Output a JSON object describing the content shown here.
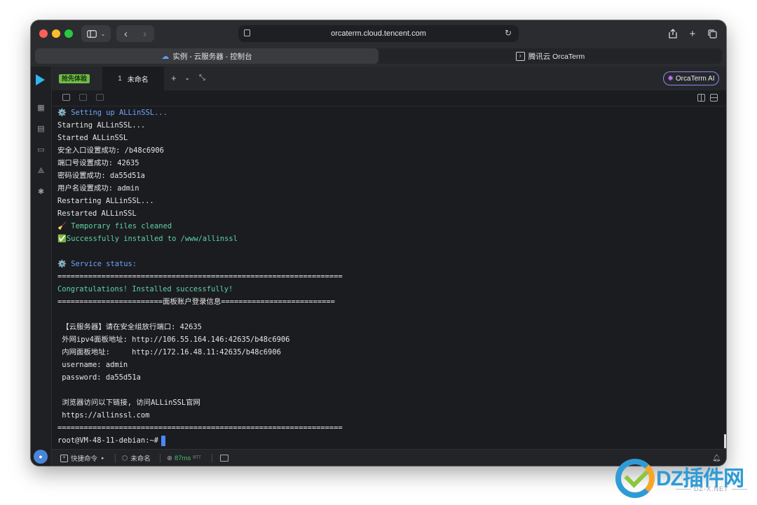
{
  "browser": {
    "url": "orcaterm.cloud.tencent.com",
    "tabs": [
      {
        "label": "实例 - 云服务器 - 控制台",
        "icon": "cloud-icon",
        "active": true
      },
      {
        "label": "腾讯云 OrcaTerm",
        "icon": "terminal-icon",
        "active": false
      }
    ]
  },
  "header": {
    "beta_badge": "抢先体验",
    "session_tab": {
      "number": "1",
      "label": "未命名"
    },
    "ai_button": "OrcaTerm AI"
  },
  "terminal": {
    "lines": [
      {
        "text": "⚙️ Setting up ALLinSSL...",
        "color": "blue"
      },
      {
        "text": "Starting ALLinSSL...",
        "color": "default"
      },
      {
        "text": "Started ALLinSSL",
        "color": "default"
      },
      {
        "text": "安全入口设置成功: /b48c6906",
        "color": "default"
      },
      {
        "text": "端口号设置成功: 42635",
        "color": "default"
      },
      {
        "text": "密码设置成功: da55d51a",
        "color": "default"
      },
      {
        "text": "用户名设置成功: admin",
        "color": "default"
      },
      {
        "text": "Restarting ALLinSSL...",
        "color": "default"
      },
      {
        "text": "Restarted ALLinSSL",
        "color": "default"
      },
      {
        "text": "🧹 Temporary files cleaned",
        "color": "green"
      },
      {
        "text": "✅Successfully installed to /www/allinssl",
        "color": "green"
      },
      {
        "text": "",
        "color": "default"
      },
      {
        "text": "⚙️ Service status:",
        "color": "blue"
      },
      {
        "text": "=================================================================",
        "color": "default"
      },
      {
        "text": "Congratulations! Installed successfully!",
        "color": "green"
      },
      {
        "text": "========================面板账户登录信息==========================",
        "color": "default"
      },
      {
        "text": "",
        "color": "default"
      },
      {
        "text": " 【云服务器】请在安全组放行端口: 42635",
        "color": "default"
      },
      {
        "text": " 外网ipv4面板地址: http://106.55.164.146:42635/b48c6906",
        "color": "default"
      },
      {
        "text": " 内网面板地址:     http://172.16.48.11:42635/b48c6906",
        "color": "default"
      },
      {
        "text": " username: admin",
        "color": "default"
      },
      {
        "text": " password: da55d51a",
        "color": "default"
      },
      {
        "text": "",
        "color": "default"
      },
      {
        "text": " 浏览器访问以下链接, 访问ALLinSSL官网",
        "color": "default"
      },
      {
        "text": " https://allinssl.com",
        "color": "default"
      },
      {
        "text": "=================================================================",
        "color": "default"
      }
    ],
    "prompt": "root@VM-48-11-debian:~#"
  },
  "statusbar": {
    "shortcut": "快捷命令",
    "session": "未命名",
    "latency": "87ms",
    "latency_unit": "RTT"
  },
  "watermark": {
    "brand": "DZ插件网",
    "domain": "DZ-X.NET"
  },
  "colors": {
    "terminal_bg": "#1b1c1f",
    "accent_blue": "#6fa3ff",
    "accent_green": "#5fd3a6",
    "beta_badge": "#71bb47",
    "cursor": "#4b87ff"
  }
}
